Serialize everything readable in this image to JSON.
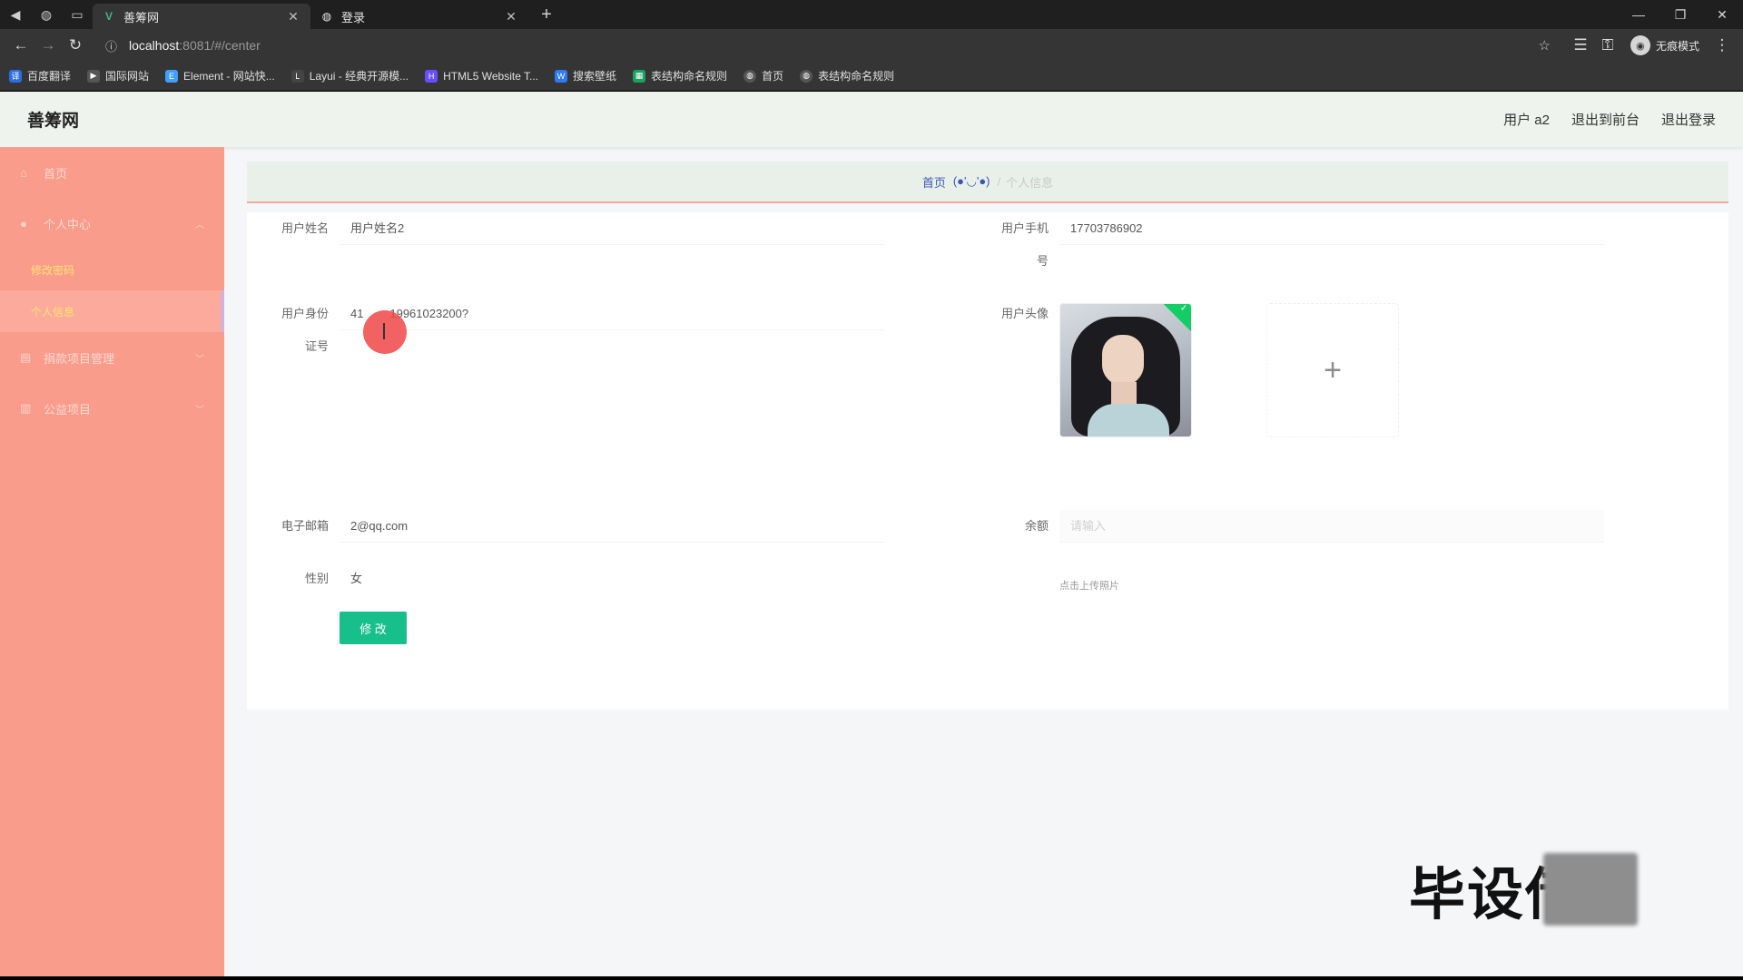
{
  "browser": {
    "tabs": [
      {
        "title": "善筹网",
        "active": true
      },
      {
        "title": "登录",
        "active": false
      }
    ],
    "address": {
      "host": "localhost",
      "path": ":8081/#/center"
    },
    "profile_label": "无痕模式",
    "bookmarks": [
      {
        "label": "百度翻译",
        "color": "#2b6de6"
      },
      {
        "label": "国际网站",
        "color": "#555555"
      },
      {
        "label": "Element - 网站快...",
        "color": "#409eff"
      },
      {
        "label": "Layui - 经典开源模...",
        "color": "#444444"
      },
      {
        "label": "HTML5 Website T...",
        "color": "#6a4cff"
      },
      {
        "label": "搜索壁纸",
        "color": "#2f7bf5"
      },
      {
        "label": "表结构命名规则",
        "color": "#1aa260"
      },
      {
        "label": "首页",
        "color": "#555555"
      },
      {
        "label": "表结构命名规则",
        "color": "#555555"
      }
    ]
  },
  "header": {
    "logo": "善筹网",
    "user": "用户 a2",
    "back_front": "退出到前台",
    "logout": "退出登录"
  },
  "sidebar": {
    "items": [
      {
        "label": "首页",
        "icon": "home-icon"
      },
      {
        "label": "个人中心",
        "icon": "user-icon"
      },
      {
        "label": "修改密码",
        "sub": true
      },
      {
        "label": "个人信息",
        "sub": true,
        "active": true
      },
      {
        "label": "捐款项目管理",
        "icon": "list-icon"
      },
      {
        "label": "公益项目",
        "icon": "chart-icon"
      }
    ]
  },
  "breadcrumb": {
    "home": "首页",
    "face": "(●'◡'●)",
    "current": "个人信息"
  },
  "form": {
    "username_label": "用户姓名",
    "username_value": "用户姓名2",
    "phone_label_1": "用户手机",
    "phone_label_2": "号",
    "phone_value": "17703786902",
    "idcard_label_1": "用户身份",
    "idcard_label_2": "证号",
    "idcard_value": "41        19961023200?",
    "avatar_label": "用户头像",
    "upload_tip": "点击上传照片",
    "email_label": "电子邮箱",
    "email_value": "2@qq.com",
    "balance_label": "余额",
    "balance_value": "请输入",
    "gender_label": "性别",
    "gender_value": "女",
    "submit": "修 改"
  },
  "watermark": "毕设借"
}
